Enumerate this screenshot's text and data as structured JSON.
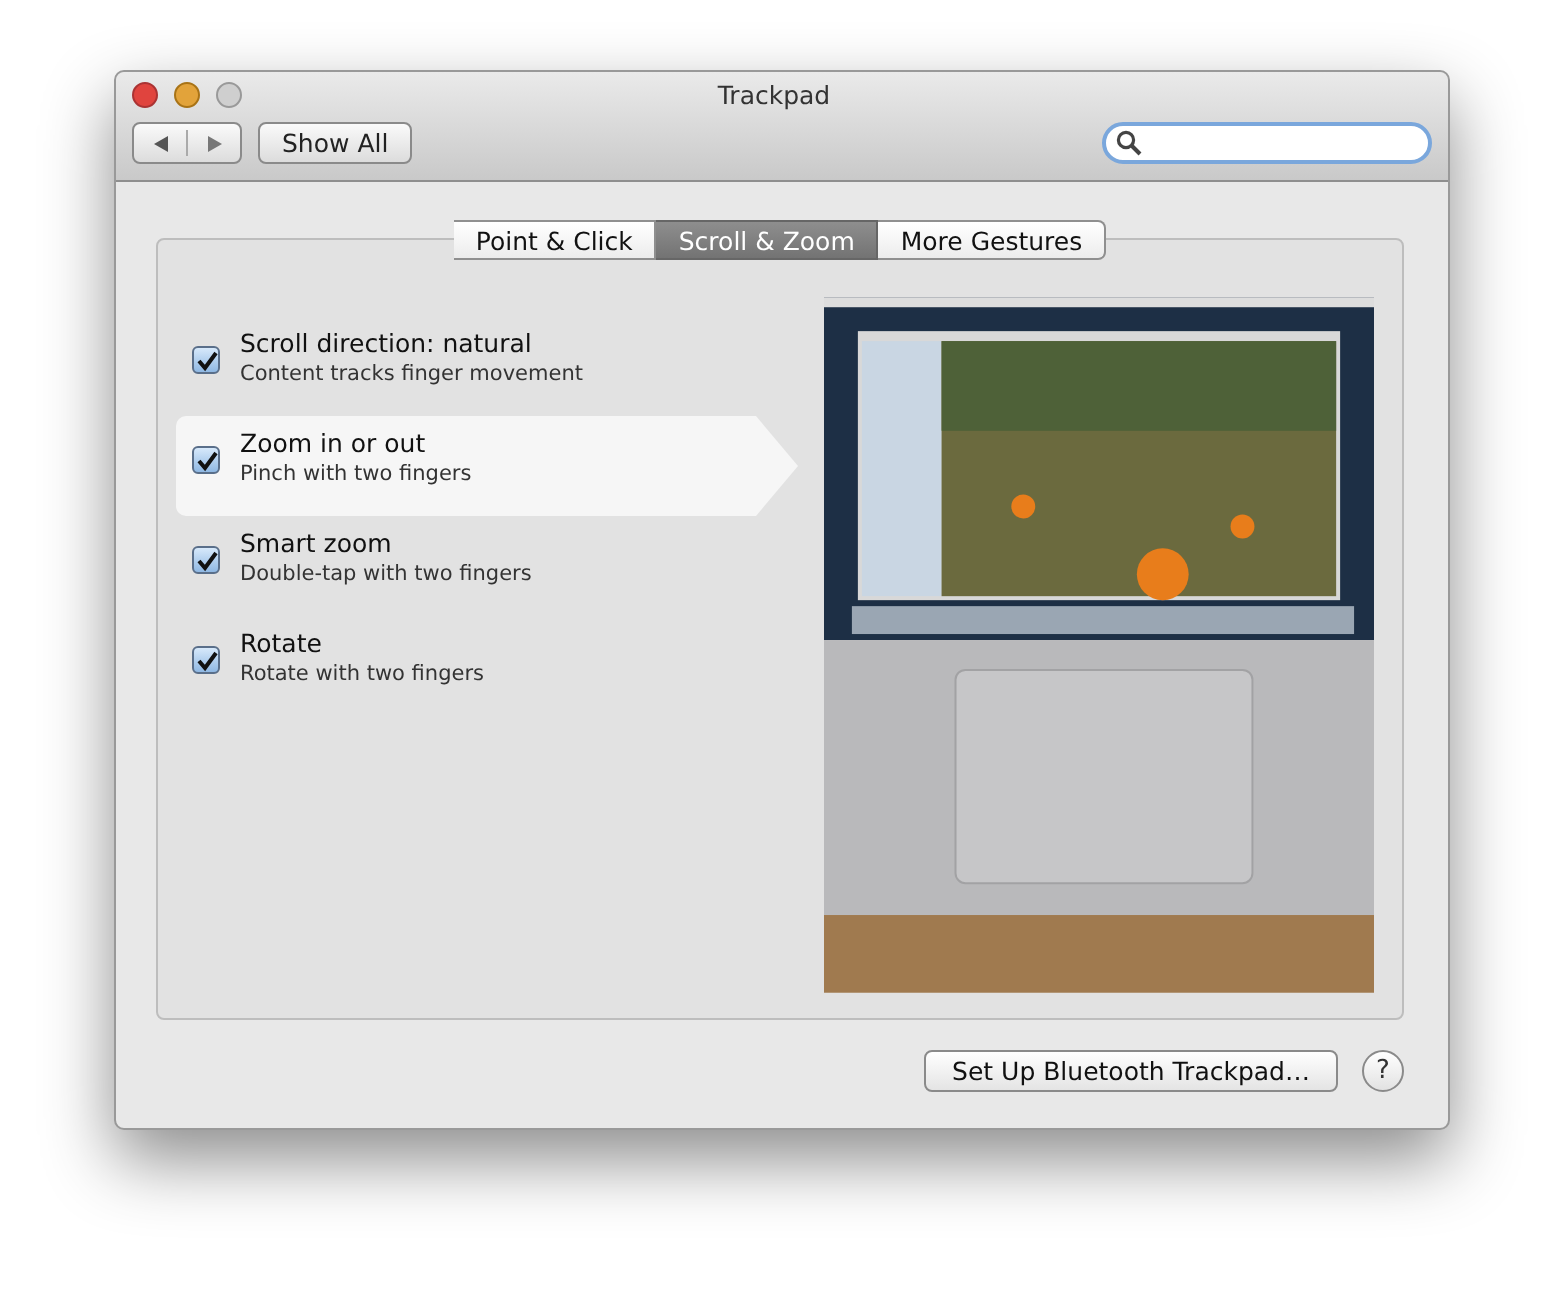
{
  "window": {
    "title": "Trackpad"
  },
  "toolbar": {
    "show_all": "Show All"
  },
  "tabs": [
    {
      "label": "Point & Click",
      "selected": false
    },
    {
      "label": "Scroll & Zoom",
      "selected": true
    },
    {
      "label": "More Gestures",
      "selected": false
    }
  ],
  "gestures": [
    {
      "title": "Scroll direction: natural",
      "subtitle": "Content tracks finger movement",
      "checked": true,
      "selected": false
    },
    {
      "title": "Zoom in or out",
      "subtitle": "Pinch with two fingers",
      "checked": true,
      "selected": true
    },
    {
      "title": "Smart zoom",
      "subtitle": "Double-tap with two fingers",
      "checked": true,
      "selected": false
    },
    {
      "title": "Rotate",
      "subtitle": "Rotate with two fingers",
      "checked": true,
      "selected": false
    }
  ],
  "footer": {
    "setup_button": "Set Up Bluetooth Trackpad…",
    "help_button": "?"
  }
}
